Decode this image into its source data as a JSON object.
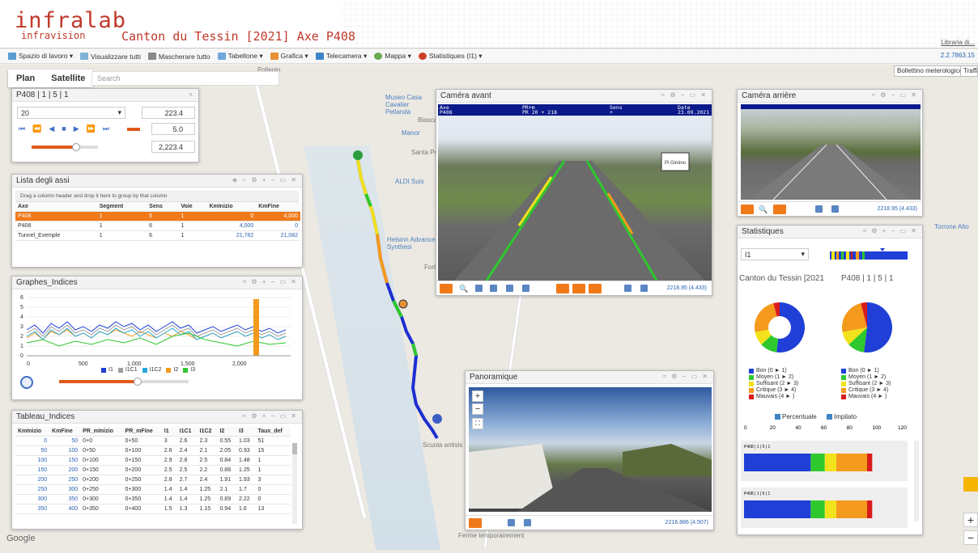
{
  "app": {
    "logo": "infralab",
    "logo_sub": "infravision",
    "title": "Canton du Tessin [2021] Axe P408",
    "link": "Libraria di...",
    "version": "2.2.7863.15"
  },
  "toolbar": [
    "Spazio di lavoro ▾",
    "Visualizzare tutti",
    "Mascherare tutto",
    "Tabellone ▾",
    "Grafica ▾",
    "Telecamera ▾",
    "Mappa ▾",
    "Statistiques (I1) ▾"
  ],
  "map": {
    "tabs": [
      "Plan",
      "Satellite"
    ],
    "search_placeholder": "Search",
    "btn_weather": "Bollettino meterologico",
    "btn_traffic": "Traffic",
    "labels": [
      "Pollegio",
      "Museo Casa Cavalier Pellanda",
      "Biasca",
      "Manor",
      "Santa Pe",
      "ALDI Suis",
      "Helsinn Advance Synthesi",
      "Fort",
      "Scuola antisis",
      "Ferme temporairement",
      "Torrone Alto",
      "Google"
    ],
    "zoom_in": "+",
    "zoom_out": "−"
  },
  "nav": {
    "title": "P408 | 1 | 5 | 1",
    "select": "20",
    "val1": "223.4",
    "val2": "5.0",
    "val3": "2,223.4"
  },
  "axes": {
    "title": "Lista degli assi",
    "hint": "Drag a column header and drop it here to group by that column",
    "columns": [
      "Axe",
      "Segment",
      "Sens",
      "Voie",
      "KmInizio",
      "KmFine"
    ],
    "rows": [
      [
        "P408",
        "1",
        "5",
        "1",
        "0",
        "4,000"
      ],
      [
        "P408",
        "1",
        "6",
        "1",
        "4,000",
        "0"
      ],
      [
        "Tunnel_Exemple",
        "1",
        "6",
        "1",
        "21,782",
        "21,082"
      ]
    ]
  },
  "graph": {
    "title": "Graphes_Indices",
    "yticks": [
      "6",
      "5",
      "4",
      "3",
      "2",
      "1",
      "0"
    ],
    "xticks": [
      "0",
      "500",
      "1,000",
      "1,500",
      "2,000"
    ],
    "legend": [
      "I1",
      "I1C1",
      "I1C2",
      "I2",
      "I3"
    ]
  },
  "tableau": {
    "title": "Tableau_Indices",
    "columns": [
      "KmInizio",
      "KmFine",
      "PR_mInizio",
      "PR_mFine",
      "I1",
      "I1C1",
      "I1C2",
      "I2",
      "I3",
      "Taux_def"
    ],
    "rows": [
      [
        "0",
        "50",
        "0+0",
        "0+50",
        "3",
        "2.6",
        "2.3",
        "0.55",
        "1.03",
        "51"
      ],
      [
        "50",
        "100",
        "0+50",
        "0+100",
        "2.6",
        "2.4",
        "2.1",
        "2.05",
        "0.93",
        "15"
      ],
      [
        "100",
        "150",
        "0+100",
        "0+150",
        "2.9",
        "2.8",
        "2.5",
        "0.84",
        "1.48",
        "1"
      ],
      [
        "150",
        "200",
        "0+150",
        "0+200",
        "2.5",
        "2.5",
        "2.2",
        "0.88",
        "1.25",
        "1"
      ],
      [
        "200",
        "250",
        "0+200",
        "0+250",
        "2.8",
        "2.7",
        "2.4",
        "1.91",
        "1.93",
        "3"
      ],
      [
        "250",
        "300",
        "0+250",
        "0+300",
        "1.4",
        "1.4",
        "1.25",
        "2.1",
        "1.7",
        "0"
      ],
      [
        "300",
        "350",
        "0+300",
        "0+350",
        "1.4",
        "1.4",
        "1.25",
        "0.89",
        "2.22",
        "0"
      ],
      [
        "350",
        "400",
        "0+350",
        "0+400",
        "1.5",
        "1.3",
        "1.15",
        "0.94",
        "1.6",
        "13"
      ]
    ]
  },
  "cam_front": {
    "title": "Caméra avant",
    "overlay": [
      "Axe",
      "P408",
      "PR+m",
      "PR 20 + 218",
      "Sens",
      "+",
      "Date",
      "23.09.2021"
    ],
    "km": "2218.95 (4.433)",
    "sign": "Pi Gimino"
  },
  "cam_rear": {
    "title": "Caméra arrière",
    "km": "2218.95 (4.433)"
  },
  "pano": {
    "title": "Panoramique",
    "km": "2216.886 (4.507)"
  },
  "stats": {
    "title": "Statistiques",
    "select": "I1",
    "left_title": "Canton du Tessin [2021",
    "right_title": "P408 | 1 | 5 | 1",
    "legend": [
      {
        "label": "Bon (0 ► 1)",
        "color": "#1f3fd6"
      },
      {
        "label": "Moyen (1 ► 2)",
        "color": "#2ec82e"
      },
      {
        "label": "Suffisant (2 ► 3)",
        "color": "#f2e21c"
      },
      {
        "label": "Critique (3 ► 4)",
        "color": "#f49a1c"
      },
      {
        "label": "Mauvais (4 ► )",
        "color": "#d81b1b"
      }
    ],
    "chk1": "Percentuale",
    "chk2": "Impilato",
    "axis": [
      "0",
      "20",
      "40",
      "60",
      "80",
      "100",
      "120"
    ],
    "bars": [
      {
        "label": "P408 | 1 | 5 | 1",
        "values": [
          52,
          11,
          9,
          24,
          4
        ]
      },
      {
        "label": "P408 | 1 | 6 | 1",
        "values": [
          52,
          11,
          9,
          24,
          4
        ]
      }
    ]
  }
}
